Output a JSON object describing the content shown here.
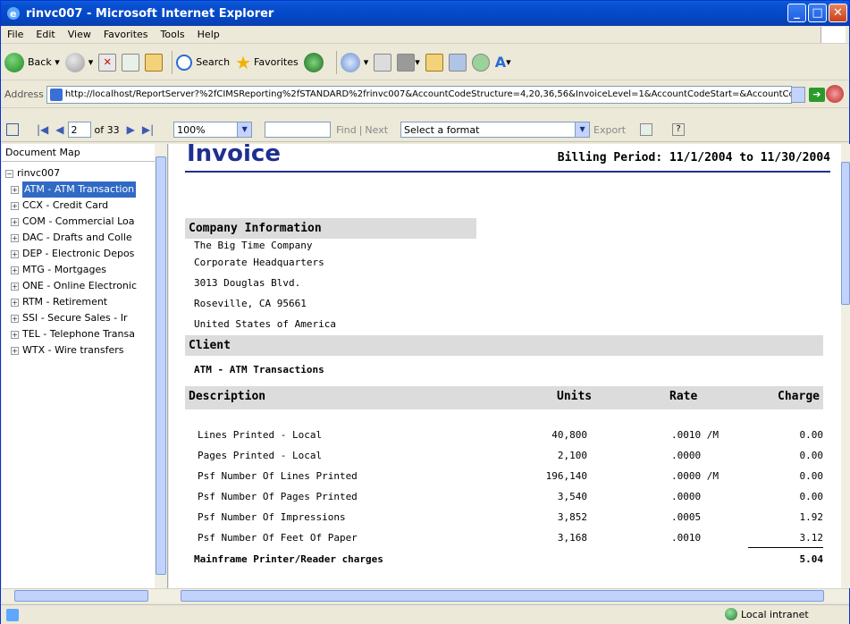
{
  "window": {
    "title": "rinvc007 - Microsoft Internet Explorer"
  },
  "menu": [
    "File",
    "Edit",
    "View",
    "Favorites",
    "Tools",
    "Help"
  ],
  "toolbar": {
    "back": "Back",
    "search": "Search",
    "favorites": "Favorites"
  },
  "address": {
    "label": "Address",
    "url": "http://localhost/ReportServer?%2fCIMSReporting%2fSTANDARD%2frinvc007&AccountCodeStructure=4,20,36,56&InvoiceLevel=1&AccountCodeStart=&AccountCc",
    "go": "Go"
  },
  "viewer": {
    "page": "2",
    "of": "of 33",
    "zoom": "100%",
    "find": "Find",
    "sep": "|",
    "next": "Next",
    "format": "Select a format",
    "export": "Export"
  },
  "docmap": {
    "header": "Document Map",
    "root": "rinvc007",
    "items": [
      "ATM - ATM Transaction",
      "CCX - Credit Card",
      "COM - Commercial Loa",
      "DAC - Drafts and Colle",
      "DEP - Electronic Depos",
      "MTG - Mortgages",
      "ONE - Online Electronic",
      "RTM - Retirement",
      "SSI - Secure Sales - Ir",
      "TEL - Telephone Transa",
      "WTX - Wire transfers"
    ]
  },
  "report": {
    "title": "Invoice",
    "billing_period": "Billing Period: 11/1/2004 to 11/30/2004",
    "company_header": "Company Information",
    "company_lines": [
      "The Big Time Company",
      "Corporate Headquarters",
      "3013 Douglas Blvd.",
      "Roseville, CA 95661",
      "United States of America"
    ],
    "client_header": "Client",
    "client_name": "ATM - ATM Transactions",
    "columns": [
      "Description",
      "Units",
      "Rate",
      "Charge"
    ],
    "rows": [
      {
        "desc": "Lines Printed - Local",
        "units": "40,800",
        "rate": ".0010 /M",
        "charge": "0.00"
      },
      {
        "desc": "Pages Printed - Local",
        "units": "2,100",
        "rate": ".0000",
        "charge": "0.00"
      },
      {
        "desc": "Psf Number Of Lines Printed",
        "units": "196,140",
        "rate": ".0000 /M",
        "charge": "0.00"
      },
      {
        "desc": "Psf Number Of Pages Printed",
        "units": "3,540",
        "rate": ".0000",
        "charge": "0.00"
      },
      {
        "desc": "Psf Number Of Impressions",
        "units": "3,852",
        "rate": ".0005",
        "charge": "1.92"
      },
      {
        "desc": "Psf Number Of Feet Of Paper",
        "units": "3,168",
        "rate": ".0010",
        "charge": "3.12"
      }
    ],
    "subtotal_label": "Mainframe Printer/Reader charges",
    "subtotal_value": "5.04"
  },
  "status": {
    "zone": "Local intranet"
  }
}
